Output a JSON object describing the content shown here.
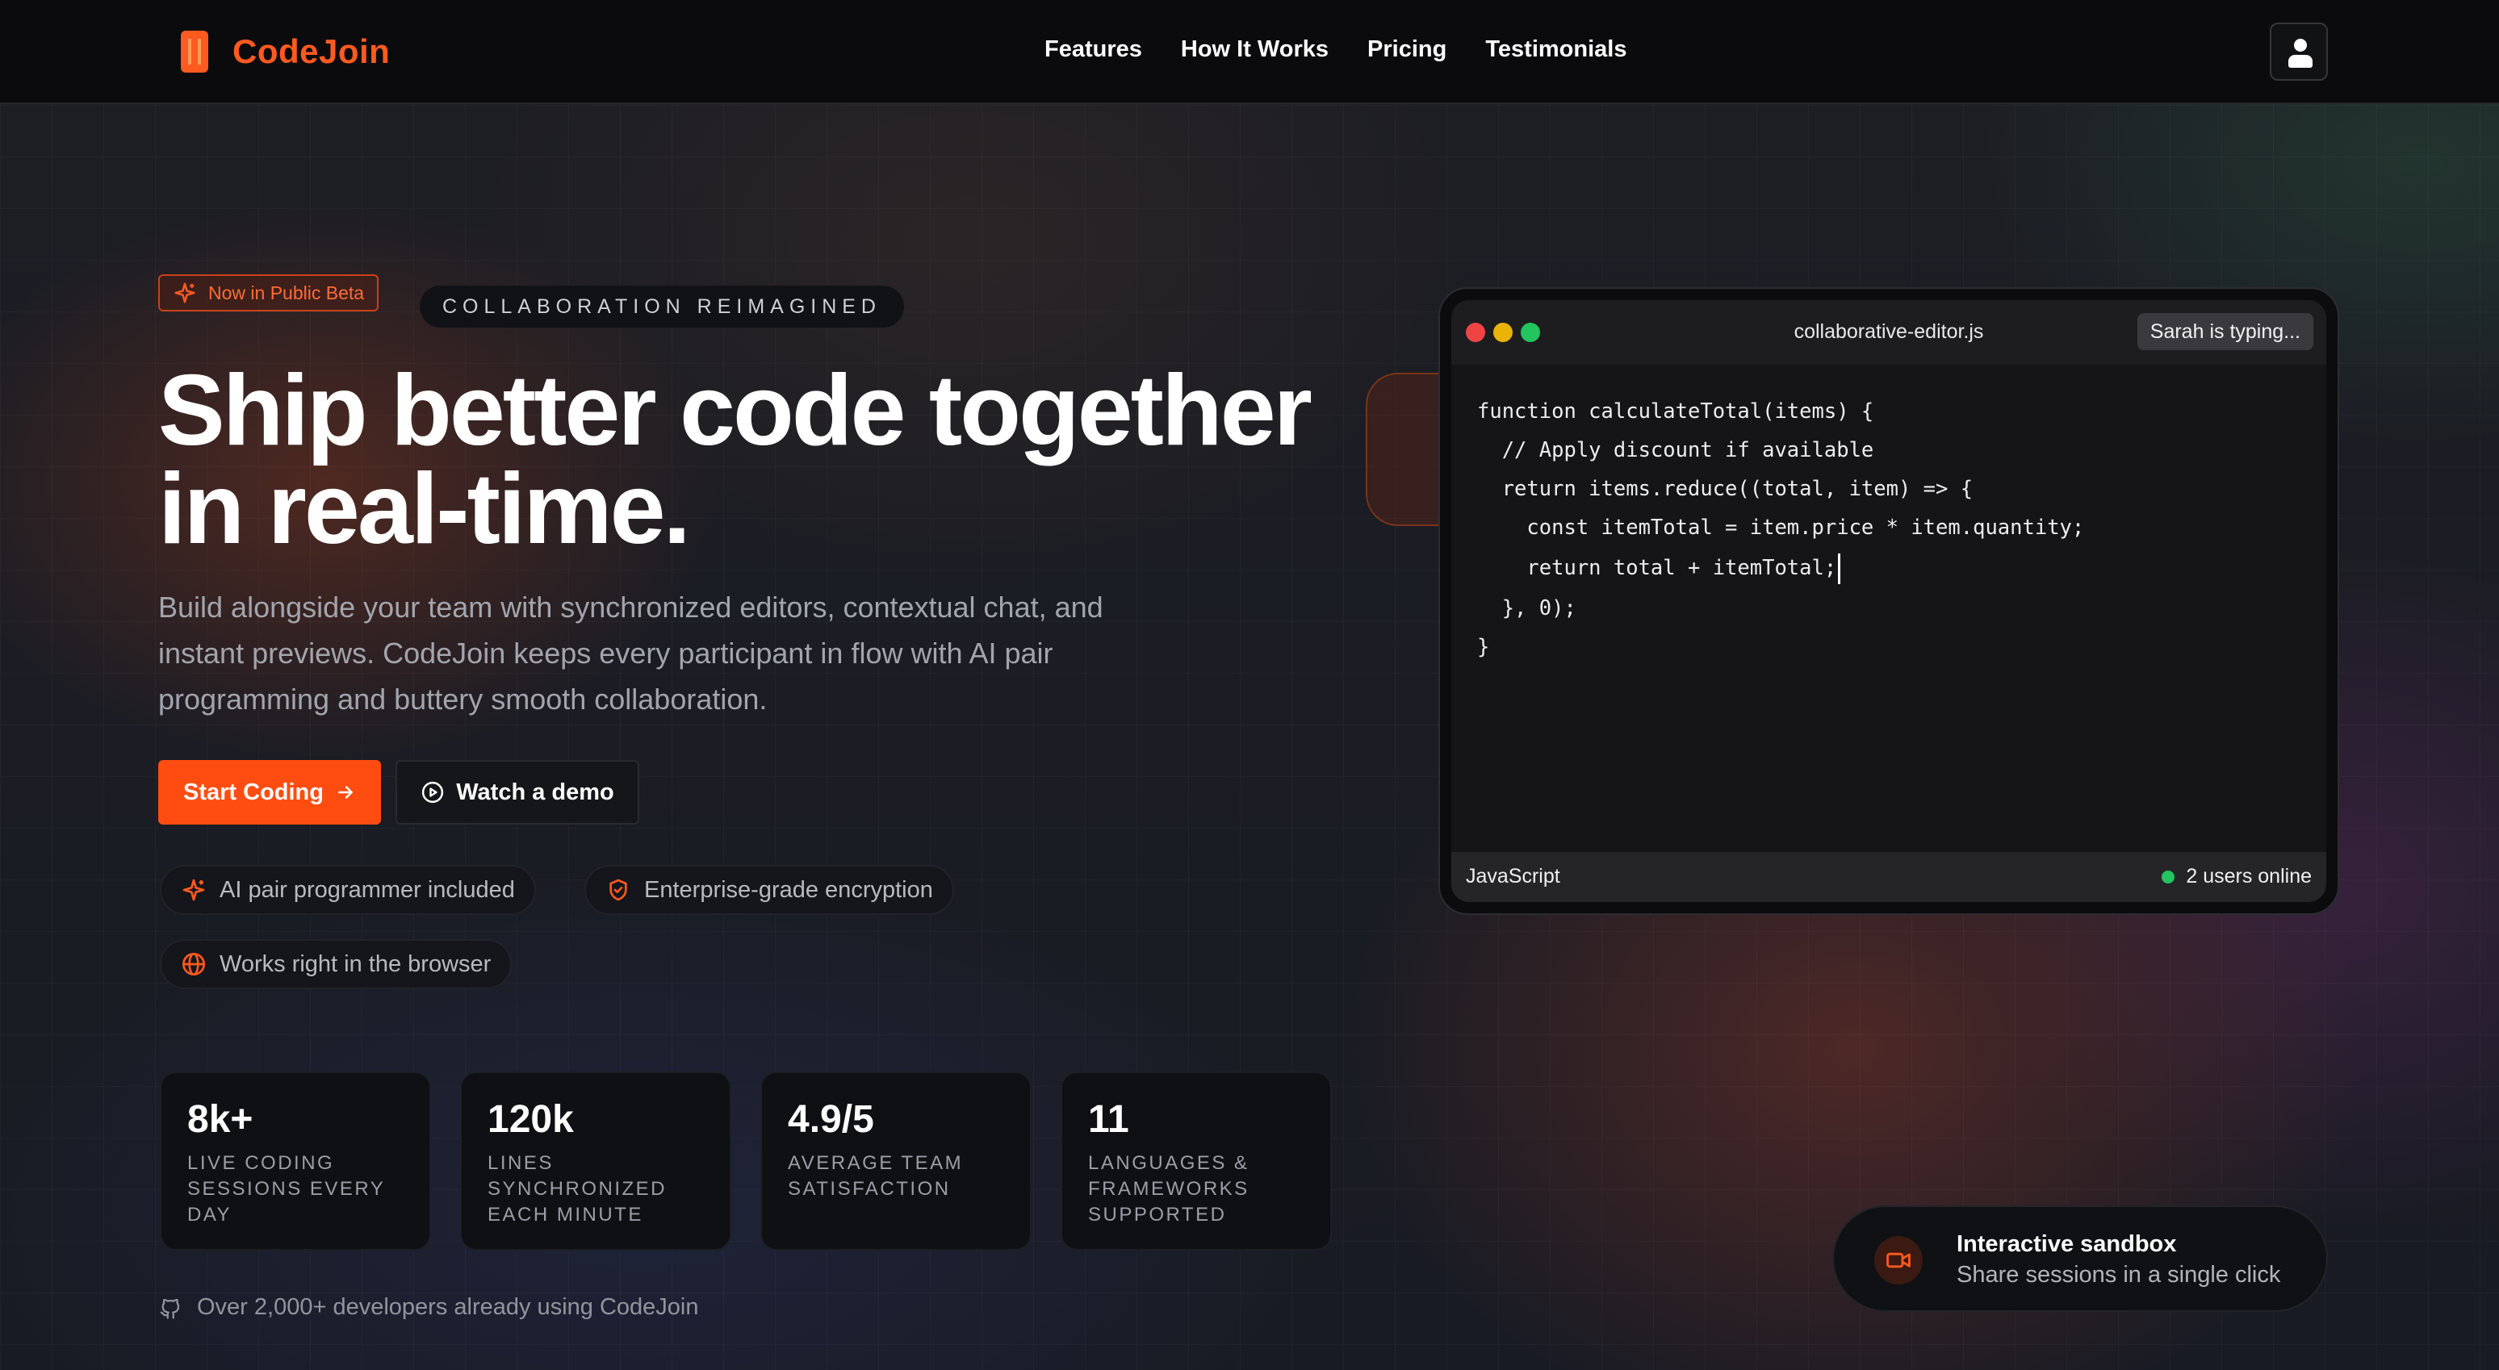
{
  "nav": {
    "brand": "CodeJoin",
    "links": [
      "Features",
      "How It Works",
      "Pricing",
      "Testimonials"
    ]
  },
  "hero": {
    "badge": "Now in Public Beta",
    "eyebrow": "COLLABORATION REIMAGINED",
    "headline_line1": "Ship better code together",
    "headline_line2": "in real-time.",
    "subtext": "Build alongside your team with synchronized editors, contextual chat, and instant previews. CodeJoin keeps every participant in flow with AI pair programming and buttery smooth collaboration.",
    "primary_cta": "Start Coding",
    "secondary_cta": "Watch a demo",
    "features": [
      "AI pair programmer included",
      "Enterprise-grade encryption",
      "Works right in the browser"
    ]
  },
  "stats": [
    {
      "value": "8k+",
      "label": "LIVE CODING SESSIONS EVERY DAY"
    },
    {
      "value": "120k",
      "label": "LINES SYNCHRONIZED EACH MINUTE"
    },
    {
      "value": "4.9/5",
      "label": "AVERAGE TEAM SATISFACTION"
    },
    {
      "value": "11",
      "label": "LANGUAGES & FRAMEWORKS SUPPORTED"
    }
  ],
  "social_proof": "Over 2,000+ developers already using CodeJoin",
  "editor": {
    "filename": "collaborative-editor.js",
    "typing_status": "Sarah is typing...",
    "code_lines": [
      "function calculateTotal(items) {",
      "  // Apply discount if available",
      "  return items.reduce((total, item) => {",
      "    const itemTotal = item.price * item.quantity;",
      "    return total + itemTotal;",
      "  }, 0);",
      "}"
    ],
    "language": "JavaScript",
    "online": "2 users online"
  },
  "sandbox": {
    "title": "Interactive sandbox",
    "subtitle": "Share sessions in a single click"
  },
  "colors": {
    "accent": "#ff4d12",
    "online_dot": "#22c55e",
    "traffic_red": "#ef4444",
    "traffic_yellow": "#eab308",
    "traffic_green": "#22c55e"
  }
}
